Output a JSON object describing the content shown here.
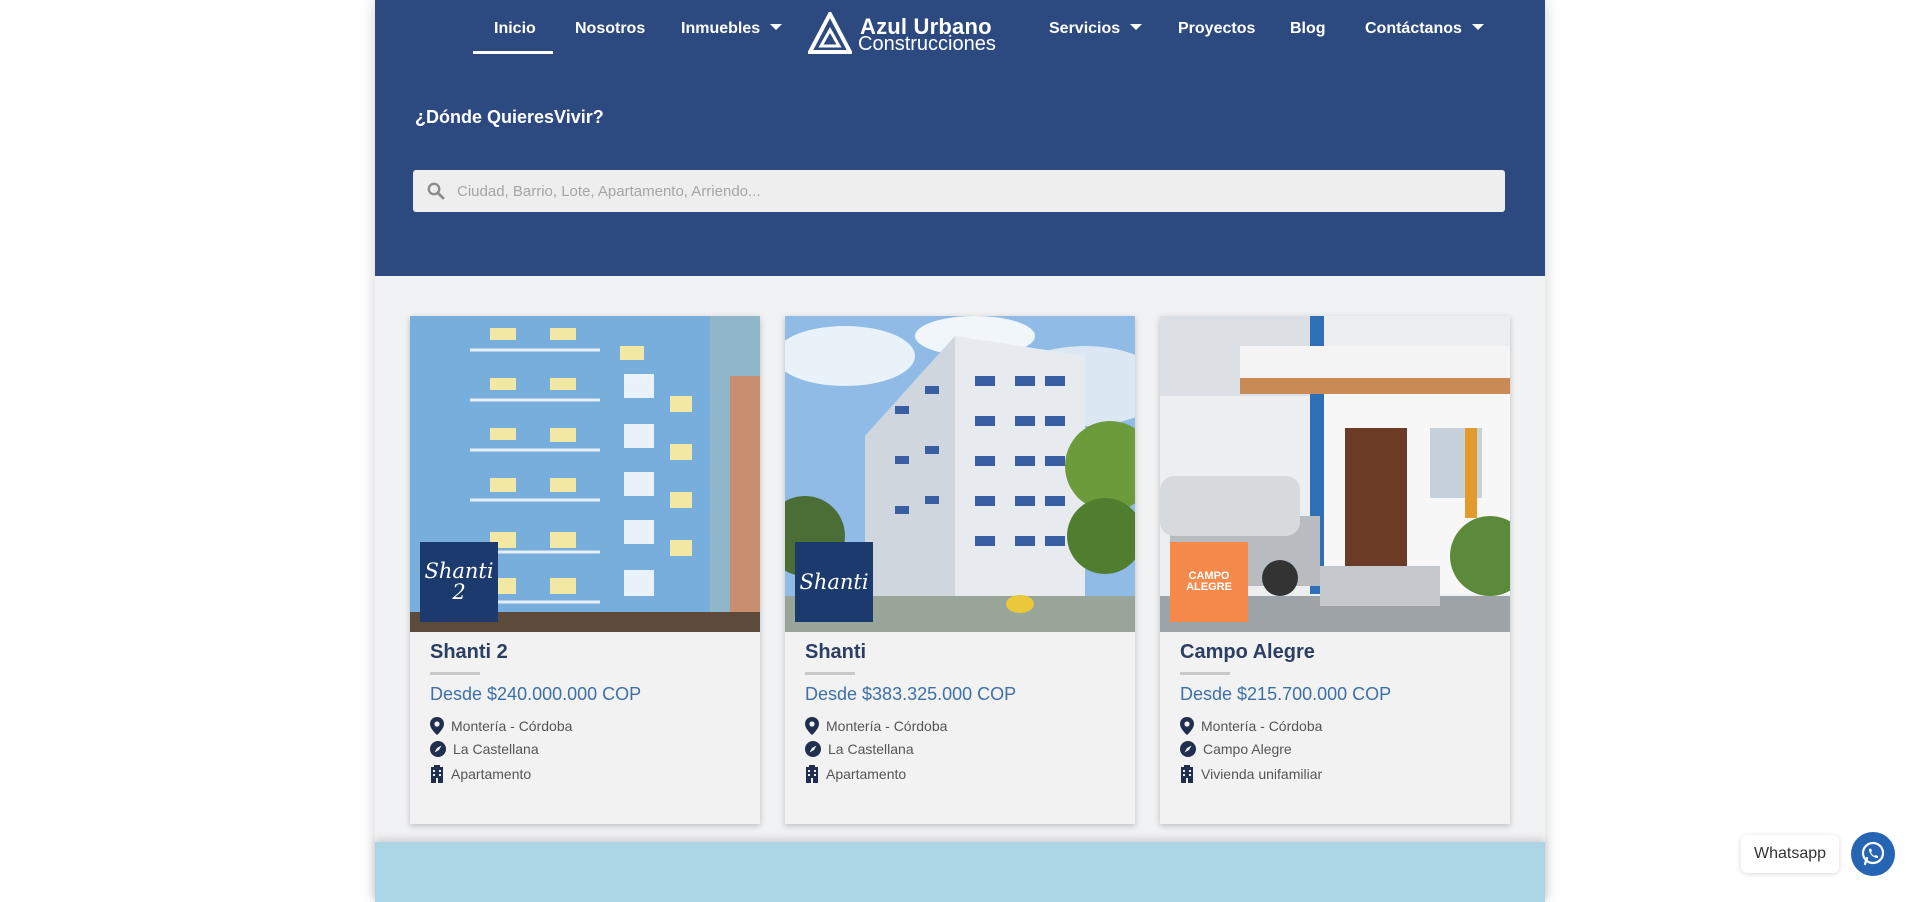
{
  "nav": {
    "left": [
      {
        "label": "Inicio",
        "dropdown": false,
        "active": true
      },
      {
        "label": "Nosotros",
        "dropdown": false,
        "active": false
      },
      {
        "label": "Inmuebles",
        "dropdown": true,
        "active": false
      }
    ],
    "right": [
      {
        "label": "Servicios",
        "dropdown": true
      },
      {
        "label": "Proyectos",
        "dropdown": false
      },
      {
        "label": "Blog",
        "dropdown": false
      },
      {
        "label": "Contáctanos",
        "dropdown": true
      }
    ]
  },
  "logo": {
    "title": "Azul Urbano",
    "subtitle": "Construcciones"
  },
  "hero": {
    "question": "¿Dónde QuieresVivir?",
    "search_placeholder": "Ciudad, Barrio, Lote, Apartamento, Arriendo..."
  },
  "cards": [
    {
      "title": "Shanti 2",
      "price": "Desde $240.000.000 COP",
      "city": "Montería - Córdoba",
      "neighborhood": "La Castellana",
      "type": "Apartamento",
      "badge": "Shanti 2",
      "badge_color": "#1d3a6e"
    },
    {
      "title": "Shanti",
      "price": "Desde $383.325.000 COP",
      "city": "Montería - Córdoba",
      "neighborhood": "La Castellana",
      "type": "Apartamento",
      "badge": "Shanti",
      "badge_color": "#1d3a6e"
    },
    {
      "title": "Campo Alegre",
      "price": "Desde $215.700.000 COP",
      "city": "Montería - Córdoba",
      "neighborhood": "Campo Alegre",
      "type": "Vivienda unifamiliar",
      "badge": "CAMPO ALEGRE",
      "badge_color": "#f58a4b"
    }
  ],
  "whatsapp": {
    "label": "Whatsapp"
  },
  "colors": {
    "primary": "#2c4a80",
    "title": "#2b3f63",
    "price": "#3d6fa8",
    "band": "#acd6e6"
  },
  "icons": [
    "search-icon",
    "chevron-down-icon",
    "map-pin-icon",
    "compass-icon",
    "building-icon",
    "whatsapp-icon"
  ]
}
